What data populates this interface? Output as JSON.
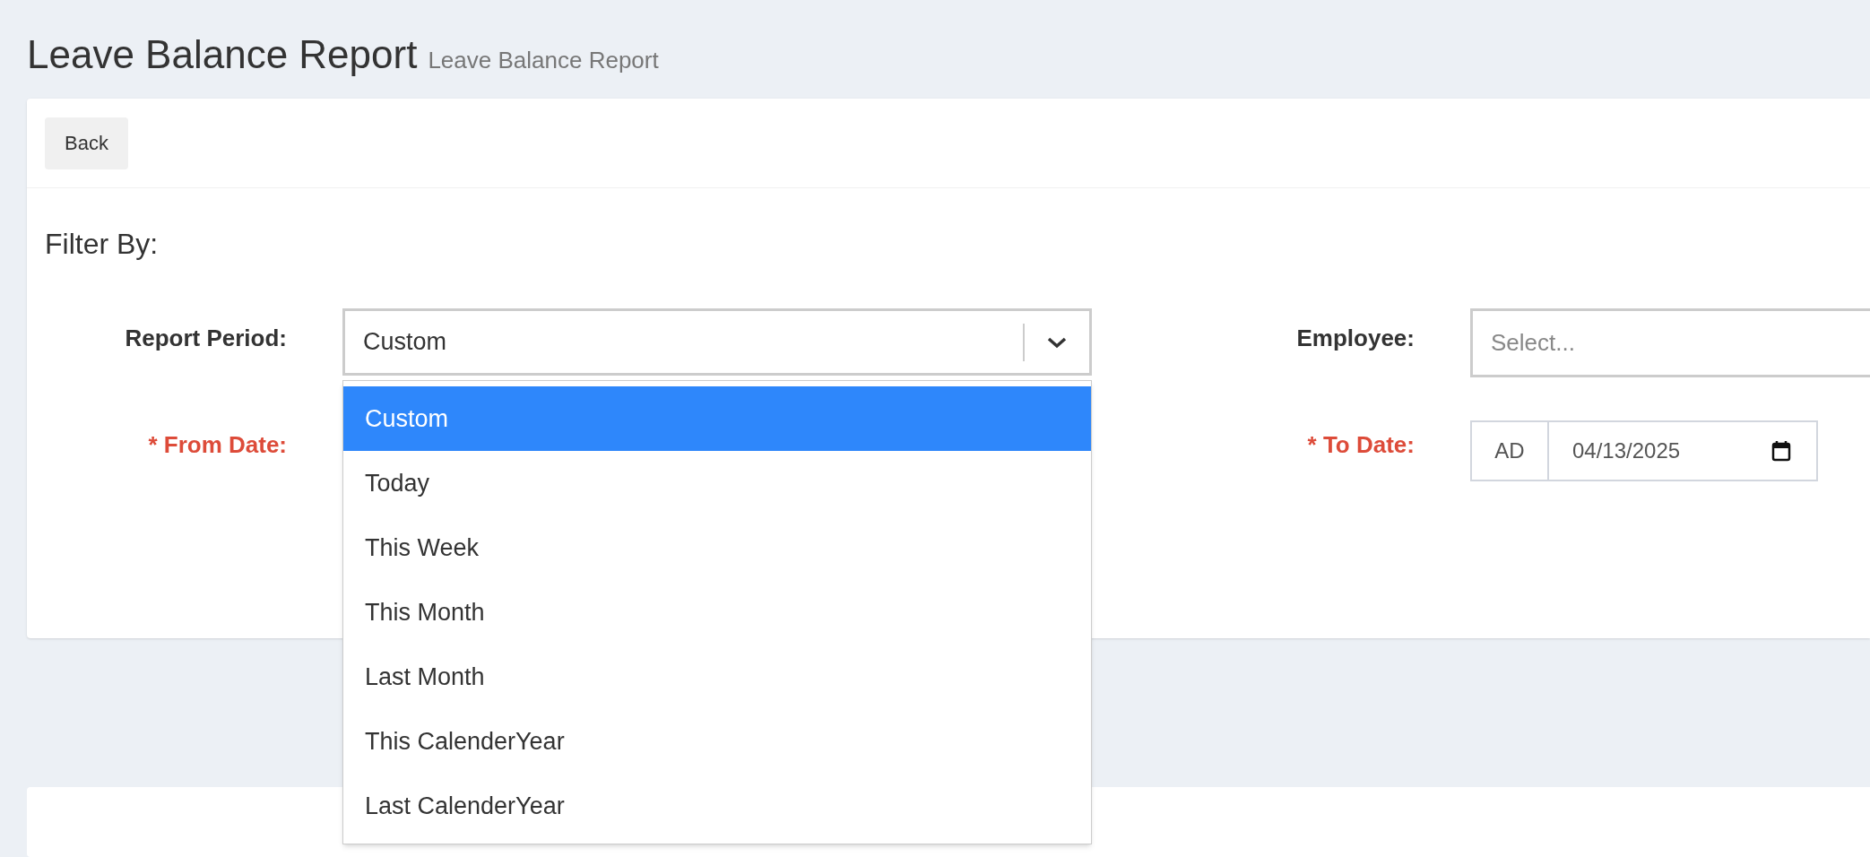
{
  "header": {
    "title": "Leave Balance Report",
    "subtitle": "Leave Balance Report"
  },
  "back_button": "Back",
  "filter": {
    "heading": "Filter By:",
    "report_period": {
      "label": "Report Period:",
      "value": "Custom",
      "expanded": true,
      "options": [
        {
          "label": "Custom",
          "selected": true
        },
        {
          "label": "Today",
          "selected": false
        },
        {
          "label": "This Week",
          "selected": false
        },
        {
          "label": "This Month",
          "selected": false
        },
        {
          "label": "Last Month",
          "selected": false
        },
        {
          "label": "This CalenderYear",
          "selected": false
        },
        {
          "label": "Last CalenderYear",
          "selected": false
        }
      ]
    },
    "employee": {
      "label": "Employee:",
      "placeholder": "Select..."
    },
    "from_date": {
      "label": "* From Date:",
      "required": true
    },
    "to_date": {
      "label": "* To Date:",
      "required": true,
      "era": "AD",
      "value": "04/13/2025"
    }
  }
}
